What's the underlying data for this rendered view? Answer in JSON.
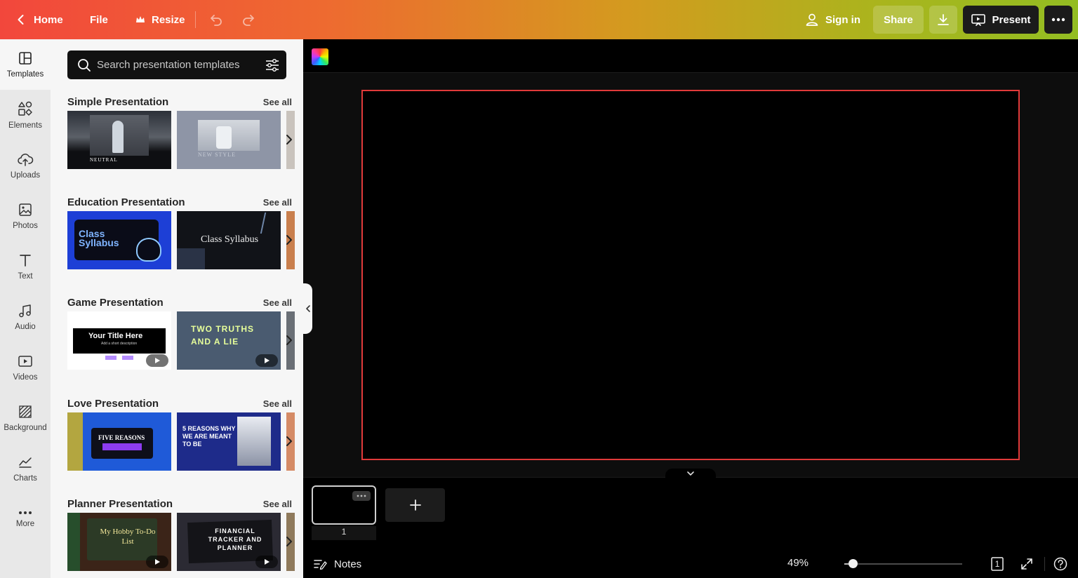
{
  "topbar": {
    "home_label": "Home",
    "file_label": "File",
    "resize_label": "Resize",
    "signin_label": "Sign in",
    "share_label": "Share",
    "present_label": "Present",
    "gradient_colors": [
      "#f2473c",
      "#ee6a30",
      "#d49a1f",
      "#a9b51d",
      "#93bd22"
    ]
  },
  "rail": {
    "items": [
      {
        "label": "Templates",
        "icon": "templates-icon",
        "active": true
      },
      {
        "label": "Elements",
        "icon": "elements-icon"
      },
      {
        "label": "Uploads",
        "icon": "upload-cloud-icon"
      },
      {
        "label": "Photos",
        "icon": "photo-icon"
      },
      {
        "label": "Text",
        "icon": "text-icon"
      },
      {
        "label": "Audio",
        "icon": "music-note-icon"
      },
      {
        "label": "Videos",
        "icon": "video-icon"
      },
      {
        "label": "Background",
        "icon": "background-icon"
      },
      {
        "label": "Charts",
        "icon": "chart-icon"
      },
      {
        "label": "More",
        "icon": "more-dots-icon"
      }
    ]
  },
  "search": {
    "placeholder": "Search presentation templates"
  },
  "sections": [
    {
      "title": "Simple Presentation",
      "see_all": "See all",
      "thumbs": [
        {
          "caption": "NEUTRAL",
          "bg": "#0e0f12"
        },
        {
          "caption": "NEW STYLE",
          "bg": "#8e95a6"
        }
      ]
    },
    {
      "title": "Education Presentation",
      "see_all": "See all",
      "thumbs": [
        {
          "caption": "Class Syllabus",
          "bg": "#1d3fd6"
        },
        {
          "caption": "Class Syllabus",
          "bg": "#111318"
        }
      ]
    },
    {
      "title": "Game Presentation",
      "see_all": "See all",
      "thumbs": [
        {
          "caption": "Your Title Here",
          "sub": "Add a short description",
          "bg": "#ffffff"
        },
        {
          "caption": "TWO TRUTHS AND A LIE",
          "bg": "#4a5b70"
        }
      ]
    },
    {
      "title": "Love Presentation",
      "see_all": "See all",
      "thumbs": [
        {
          "caption": "FIVE REASONS",
          "bg": "#1f5ad8"
        },
        {
          "caption": "5 REASONS WHY WE ARE MEANT TO BE",
          "bg": "#1e2b8a"
        }
      ]
    },
    {
      "title": "Planner Presentation",
      "see_all": "See all",
      "thumbs": [
        {
          "caption": "My Hobby To-Do List",
          "bg": "#3b2418"
        },
        {
          "caption": "FINANCIAL TRACKER AND PLANNER",
          "bg": "#2b2a33"
        }
      ]
    }
  ],
  "editor": {
    "page_border_color": "#e03a3a",
    "page_number": "1"
  },
  "footer": {
    "notes_label": "Notes",
    "zoom_label": "49%",
    "zoom_value": 0.04,
    "page_count": "1"
  }
}
